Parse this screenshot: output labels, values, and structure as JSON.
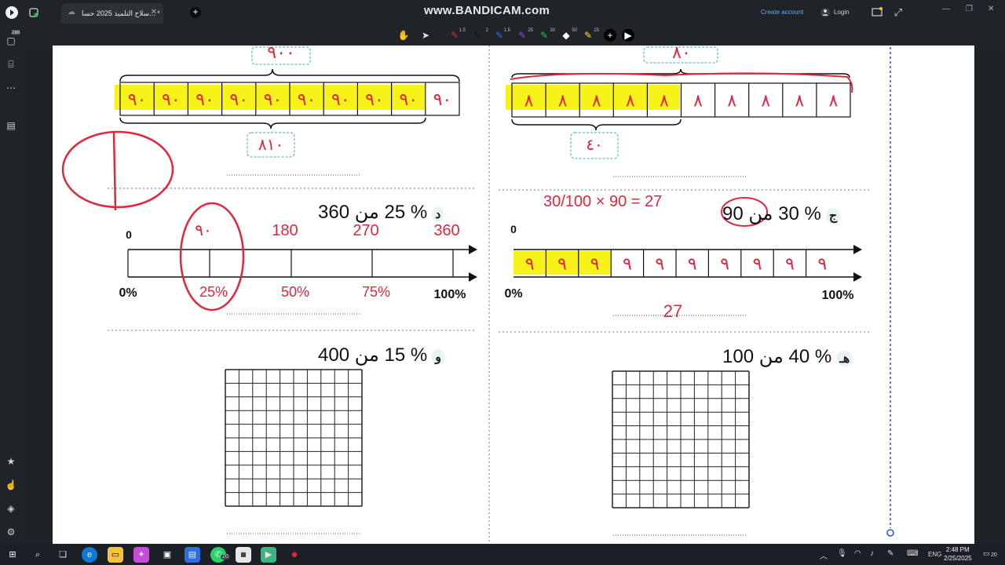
{
  "app": {
    "tab_title": "سلاح التلميذ 2025 حسا... *",
    "watermark": "www.BANDICAM.com",
    "create_account": "Create account",
    "login": "Login"
  },
  "toolbar": {
    "tools": [
      {
        "name": "hand-tool",
        "glyph": "✋"
      },
      {
        "name": "pointer-tool",
        "glyph": "➤"
      },
      {
        "name": "pen-red-tool",
        "glyph": "✎",
        "color": "#e0283c",
        "size": "1.5"
      },
      {
        "name": "pen-black-tool",
        "glyph": "✎",
        "color": "#111111",
        "size": "2"
      },
      {
        "name": "pen-blue-tool",
        "glyph": "✎",
        "color": "#2f6cf5",
        "size": "1.5"
      },
      {
        "name": "pen-purple-tool",
        "glyph": "✎",
        "color": "#9a45e8",
        "size": "25"
      },
      {
        "name": "pen-green-tool",
        "glyph": "✎",
        "color": "#1fc23a",
        "size": "30"
      },
      {
        "name": "eraser-tool",
        "glyph": "◆",
        "color": "#ffffff",
        "size": "50"
      },
      {
        "name": "highlighter-tool",
        "glyph": "✎",
        "color": "#f6e51a",
        "size": "25"
      },
      {
        "name": "add-tool",
        "glyph": "+"
      },
      {
        "name": "more-tool",
        "glyph": "▶"
      }
    ]
  },
  "sidebar": {
    "badge": "288"
  },
  "worksheet": {
    "top_left_tape": {
      "cells": [
        "٩٠",
        "٩٠",
        "٩٠",
        "٩٠",
        "٩٠",
        "٩٠",
        "٩٠",
        "٩٠",
        "٩٠",
        "٩٠"
      ],
      "top_brace_value": "٩٠٠",
      "bottom_brace_value": "٨١٠"
    },
    "top_right_tape": {
      "cells": [
        "٨",
        "٨",
        "٨",
        "٨",
        "٨",
        "٨",
        "٨",
        "٨",
        "٨",
        "٨"
      ],
      "top_brace_value": "٨٠",
      "bottom_brace_value": "٤٠"
    },
    "q_d": {
      "letter": "د",
      "text": "% 25 من 360",
      "start": "0",
      "left_pct": "0%",
      "right_pct": "100%",
      "hand_top": [
        "٩٠",
        "180",
        "270",
        "360"
      ],
      "hand_bottom": [
        "25%",
        "50%",
        "75%"
      ]
    },
    "q_c": {
      "letter": "ج",
      "text": "% 30 من 90",
      "start": "0",
      "left_pct": "0%",
      "right_pct": "100%",
      "cells": [
        "٩",
        "٩",
        "٩",
        "٩",
        "٩",
        "٩",
        "٩",
        "٩",
        "٩",
        "٩"
      ],
      "hand_formula": "30/100 × 90 = 27",
      "hand_answer": "27"
    },
    "q_w": {
      "letter": "و",
      "text": "% 15 من 400"
    },
    "q_h": {
      "letter": "هـ",
      "text": "% 40 من 100"
    }
  },
  "taskbar": {
    "whatsapp_badge": "20",
    "lang": "ENG",
    "time": "2:48 PM",
    "date": "2/25/2025",
    "notif": "20"
  }
}
